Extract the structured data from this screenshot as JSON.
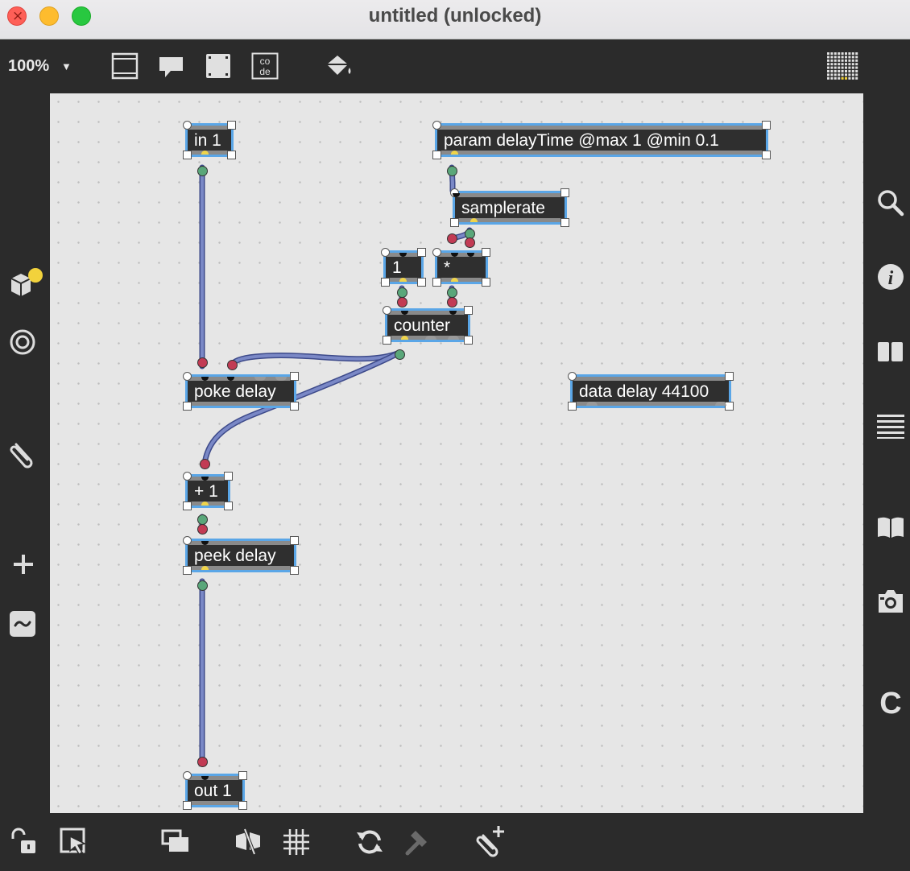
{
  "window": {
    "title": "untitled (unlocked)"
  },
  "toolbar": {
    "zoom": "100%",
    "icons": [
      "presentation-icon",
      "comment-icon",
      "frame-icon",
      "code-icon",
      "paint-bucket-icon",
      "grid-matrix-icon"
    ],
    "code_icon_text_top": "co",
    "code_icon_text_bottom": "de"
  },
  "left_sidebar": {
    "icons": [
      "package-icon",
      "target-icon",
      "paperclip-icon",
      "plus-icon",
      "tilde-icon"
    ]
  },
  "right_sidebar": {
    "icons": [
      "search-icon",
      "info-icon",
      "columns-icon",
      "list-icon",
      "book-icon",
      "camera-icon",
      "c-icon"
    ]
  },
  "bottom_bar": {
    "icons": [
      "lock-icon",
      "select-icon",
      "windows-icon",
      "hide-cable-icon",
      "grid-icon",
      "refresh-icon",
      "hammer-icon",
      "attach-plus-icon"
    ]
  },
  "patch": {
    "objects": [
      {
        "id": "in1",
        "text": "in 1"
      },
      {
        "id": "param",
        "text": "param delayTime @max 1 @min 0.1"
      },
      {
        "id": "samplerate",
        "text": "samplerate"
      },
      {
        "id": "one",
        "text": "1"
      },
      {
        "id": "mul",
        "text": "*"
      },
      {
        "id": "counter",
        "text": "counter"
      },
      {
        "id": "poke",
        "text": "poke delay"
      },
      {
        "id": "data",
        "text": "data delay 44100"
      },
      {
        "id": "plus1",
        "text": "+ 1"
      },
      {
        "id": "peek",
        "text": "peek delay"
      },
      {
        "id": "out1",
        "text": "out 1"
      }
    ]
  },
  "colors": {
    "selection": "#5aa6e7",
    "canvas": "#e6e6e6",
    "object": "#2f2f2f",
    "cable": "#7a88c6",
    "inlet_node": "#c23b54",
    "outlet_node": "#5aa77a"
  }
}
